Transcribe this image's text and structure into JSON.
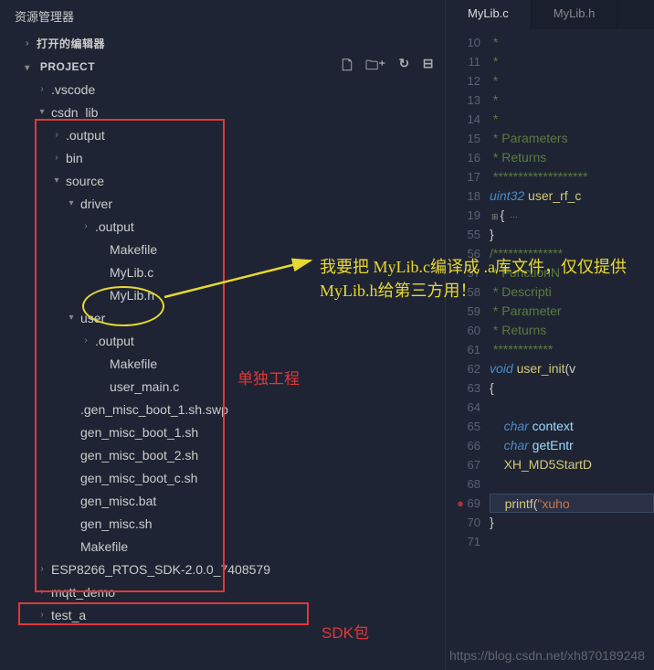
{
  "sidebar": {
    "title": "资源管理器",
    "sections": {
      "open_editors": "打开的编辑器",
      "project": "PROJECT"
    },
    "tree": [
      {
        "label": ".vscode",
        "indent": 2,
        "chevron": "›"
      },
      {
        "label": "csdn_lib",
        "indent": 2,
        "chevron": "▾"
      },
      {
        "label": ".output",
        "indent": 3,
        "chevron": "›"
      },
      {
        "label": "bin",
        "indent": 3,
        "chevron": "›"
      },
      {
        "label": "source",
        "indent": 3,
        "chevron": "▾"
      },
      {
        "label": "driver",
        "indent": 4,
        "chevron": "▾"
      },
      {
        "label": ".output",
        "indent": 5,
        "chevron": "›"
      },
      {
        "label": "Makefile",
        "indent": 6,
        "chevron": ""
      },
      {
        "label": "MyLib.c",
        "indent": 6,
        "chevron": ""
      },
      {
        "label": "MyLib.h",
        "indent": 6,
        "chevron": ""
      },
      {
        "label": "user",
        "indent": 4,
        "chevron": "▾"
      },
      {
        "label": ".output",
        "indent": 5,
        "chevron": "›"
      },
      {
        "label": "Makefile",
        "indent": 6,
        "chevron": ""
      },
      {
        "label": "user_main.c",
        "indent": 6,
        "chevron": ""
      },
      {
        "label": ".gen_misc_boot_1.sh.swp",
        "indent": 4,
        "chevron": ""
      },
      {
        "label": "gen_misc_boot_1.sh",
        "indent": 4,
        "chevron": ""
      },
      {
        "label": "gen_misc_boot_2.sh",
        "indent": 4,
        "chevron": ""
      },
      {
        "label": "gen_misc_boot_c.sh",
        "indent": 4,
        "chevron": ""
      },
      {
        "label": "gen_misc.bat",
        "indent": 4,
        "chevron": ""
      },
      {
        "label": "gen_misc.sh",
        "indent": 4,
        "chevron": ""
      },
      {
        "label": "Makefile",
        "indent": 4,
        "chevron": ""
      },
      {
        "label": "ESP8266_RTOS_SDK-2.0.0_7408579",
        "indent": 2,
        "chevron": "›"
      },
      {
        "label": "mqtt_demo",
        "indent": 2,
        "chevron": "›"
      },
      {
        "label": "test_a",
        "indent": 2,
        "chevron": "›"
      }
    ],
    "actions": [
      "new-file",
      "new-folder",
      "refresh",
      "collapse"
    ]
  },
  "tabs": [
    {
      "label": "MyLib.c",
      "active": true
    },
    {
      "label": "MyLib.h",
      "active": false
    }
  ],
  "code": {
    "lineNumbers": [
      10,
      11,
      12,
      13,
      14,
      15,
      16,
      17,
      18,
      19,
      55,
      56,
      57,
      58,
      59,
      60,
      61,
      62,
      63,
      64,
      65,
      66,
      67,
      68,
      69,
      70,
      71
    ],
    "lines": {
      "l10": " *",
      "l11": " *",
      "l12": " *",
      "l13": " *",
      "l14": " *",
      "l15": " * Parameters",
      "l16": " * Returns",
      "l17": " *******************",
      "l18_type": "uint32",
      "l18_func": " user_rf_c",
      "l19": "{",
      "l19_fold": "⊞",
      "l55": "}",
      "l56": "/**************",
      "l57": " * FunctionN",
      "l58": " * Descripti",
      "l59": " * Parameter",
      "l60": " * Returns",
      "l61": " ************",
      "l62_kw": "void",
      "l62_func": " user_init",
      "l62_tail": "(v",
      "l63": "{",
      "l65_kw": "char",
      "l65_id": " context",
      "l66_kw": "char",
      "l66_id": " getEntr",
      "l67": "XH_MD5StartD",
      "l69_func": "printf",
      "l69_str": "\"xuho",
      "l70": "}"
    }
  },
  "annotations": {
    "yellow_text": "我要把 MyLib.c编译成 .a库文件，仅仅提供 MyLib.h给第三方用！",
    "red_text1": "单独工程",
    "red_text2": "SDK包",
    "watermark": "https://blog.csdn.net/xh870189248"
  }
}
